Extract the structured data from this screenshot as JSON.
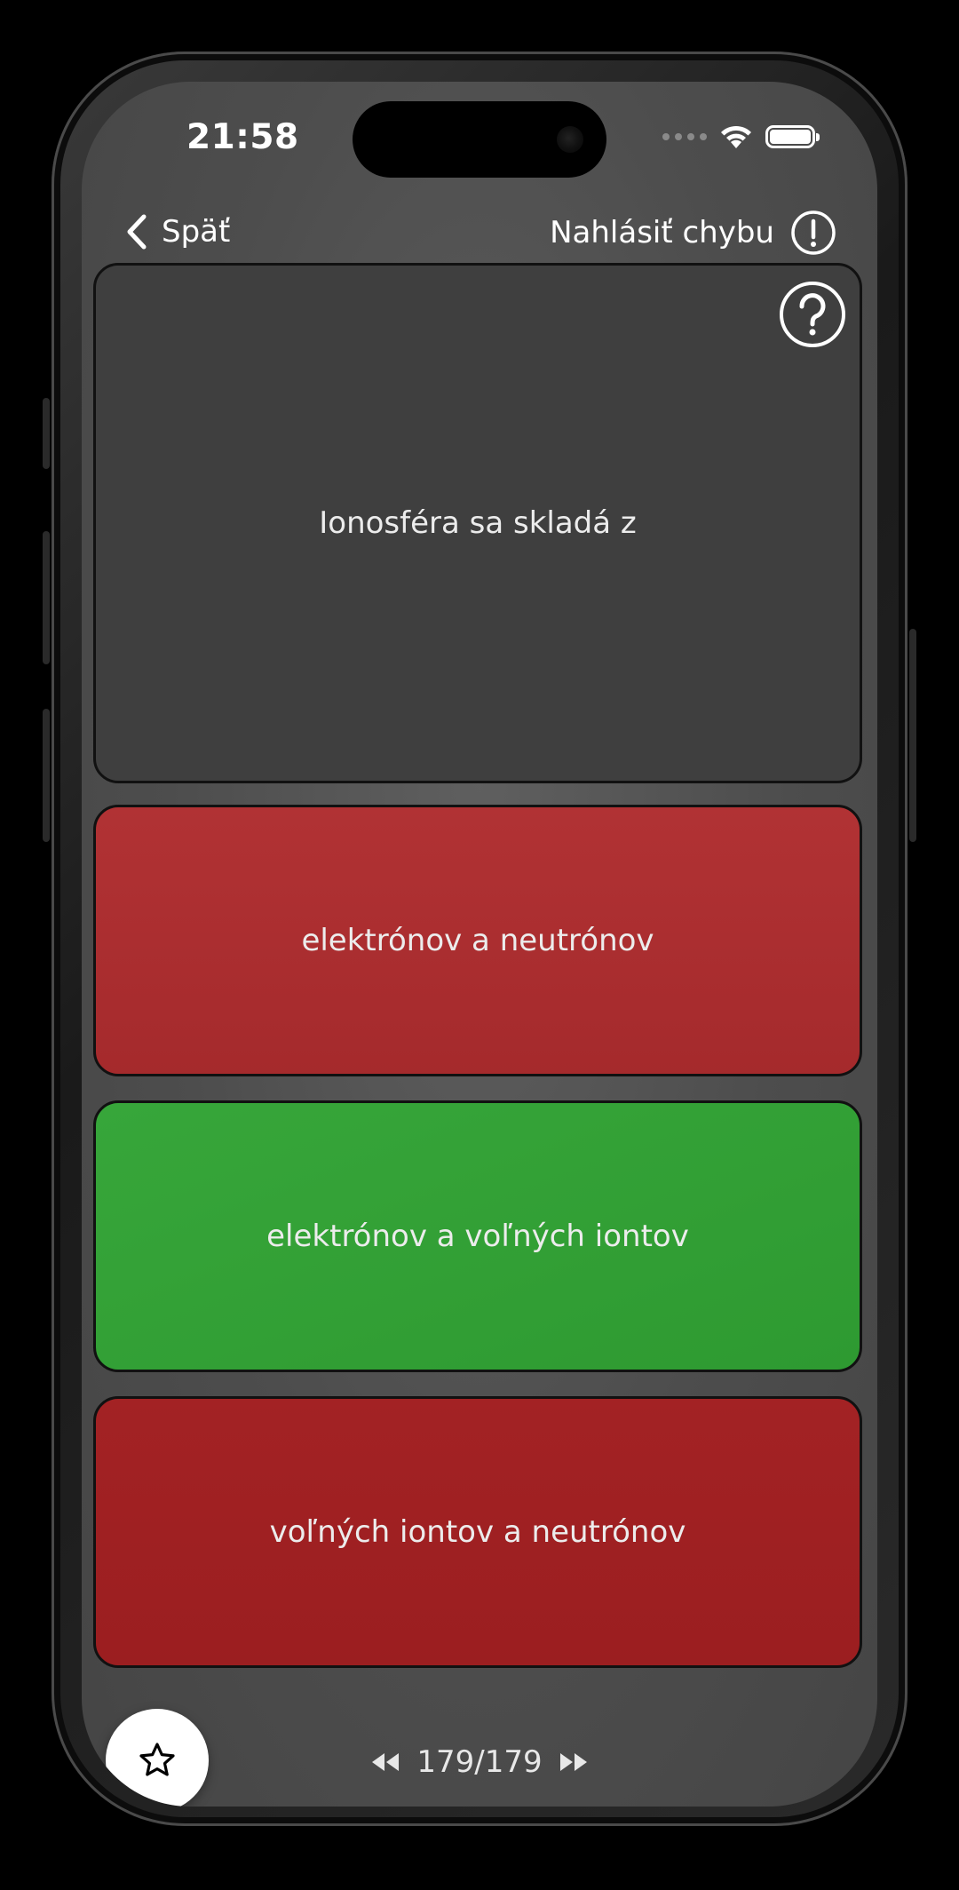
{
  "status_bar": {
    "time": "21:58"
  },
  "nav": {
    "back_label": "Späť",
    "report_label": "Nahlásiť chybu"
  },
  "question": {
    "text": "Ionosféra sa skladá z"
  },
  "answers": [
    {
      "text": "elektrónov a neutrónov",
      "state": "incorrect",
      "color": "#ab2e30"
    },
    {
      "text": "elektrónov a voľných iontov",
      "state": "correct",
      "color": "#33a136"
    },
    {
      "text": "voľných iontov a neutrónov",
      "state": "incorrect",
      "color": "#9f2022"
    }
  ],
  "footer": {
    "pager_label": "179/179"
  },
  "icons": {
    "back": "chevron-left-icon",
    "report": "exclamation-circle-icon",
    "help": "question-circle-icon",
    "favorite": "star-outline-icon",
    "prev": "rewind-icon",
    "next": "fast-forward-icon"
  }
}
